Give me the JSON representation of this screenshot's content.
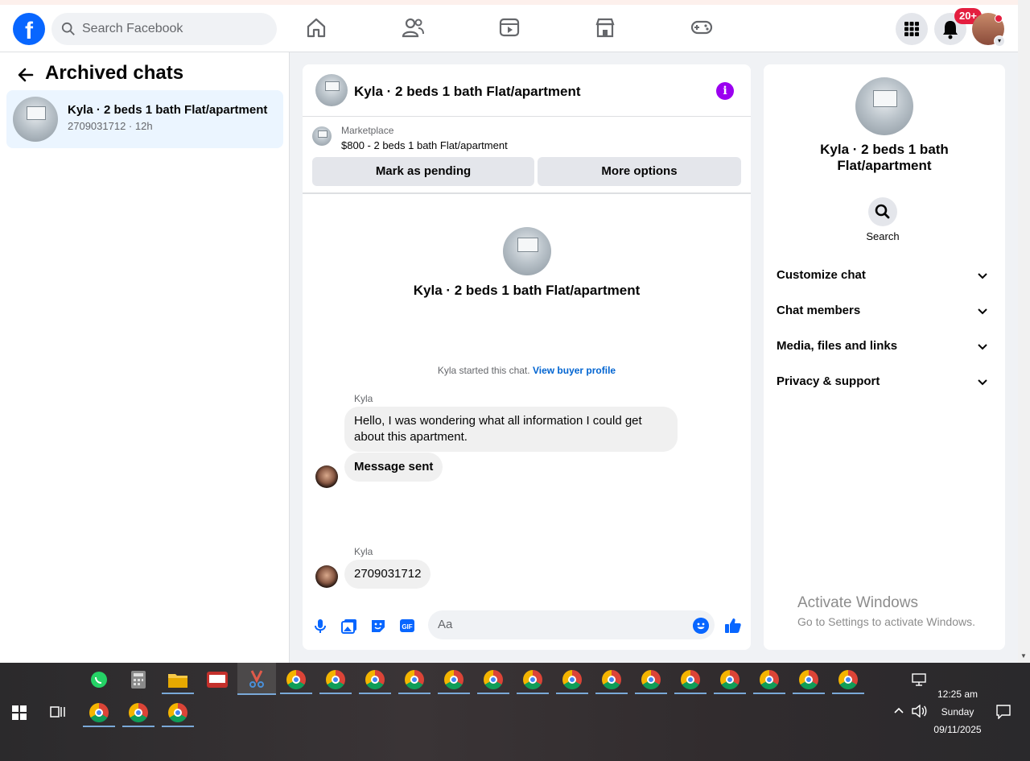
{
  "header": {
    "search_placeholder": "Search Facebook",
    "notification_badge": "20+",
    "nav_icons": [
      "home-icon",
      "friends-icon",
      "video-icon",
      "marketplace-icon",
      "gaming-icon"
    ]
  },
  "sidebar": {
    "title": "Archived chats",
    "chats": [
      {
        "name": "Kyla · 2 beds 1 bath Flat/apartment",
        "subtitle": "2709031712 · 12h"
      }
    ]
  },
  "chat": {
    "title": "Kyla · 2 beds 1 bath Flat/apartment",
    "marketplace": {
      "label": "Marketplace",
      "listing": "$800 - 2 beds 1 bath Flat/apartment",
      "mark_pending_label": "Mark as pending",
      "more_options_label": "More options"
    },
    "intro_name": "Kyla · 2 beds 1 bath Flat/apartment",
    "started_text": "Kyla started this chat.",
    "view_buyer_profile": "View buyer profile",
    "messages": [
      {
        "sender": "Kyla",
        "text": "Hello, I was wondering what all information I could get about this apartment."
      },
      {
        "sender": "",
        "text": "Message sent"
      },
      {
        "sender": "Kyla",
        "text": "2709031712"
      }
    ],
    "composer_placeholder": "Aa"
  },
  "details": {
    "name": "Kyla · 2 beds 1 bath Flat/apartment",
    "search_label": "Search",
    "sections": [
      "Customize chat",
      "Chat members",
      "Media, files and links",
      "Privacy & support"
    ]
  },
  "watermark": {
    "title": "Activate Windows",
    "subtitle": "Go to Settings to activate Windows."
  },
  "taskbar": {
    "time": "12:25 am",
    "day": "Sunday",
    "date": "09/11/2025"
  },
  "colors": {
    "facebook_blue": "#0866ff",
    "selected_chat_bg": "#ebf5ff",
    "info_purple": "#9b00f0",
    "link_blue": "#0064d1"
  }
}
